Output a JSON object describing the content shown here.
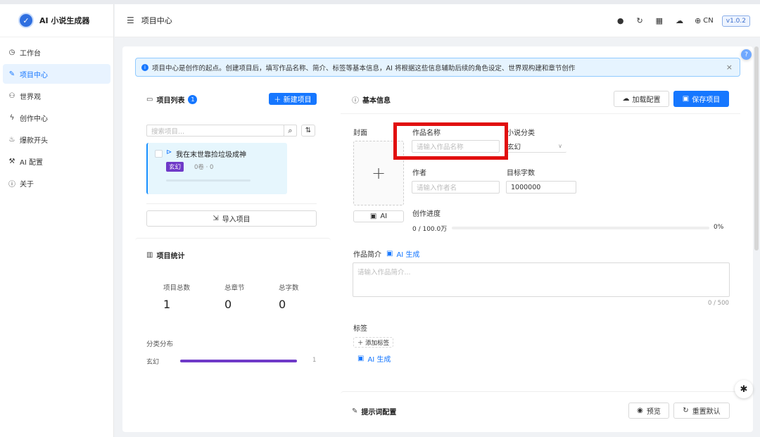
{
  "app": {
    "title": "AI 小说生成器",
    "logo_glyph": "✓"
  },
  "sidebar": {
    "items": [
      {
        "label": "工作台",
        "icon": "dashboard-icon",
        "glyph": "◷"
      },
      {
        "label": "项目中心",
        "icon": "edit-icon",
        "glyph": "✎"
      },
      {
        "label": "世界观",
        "icon": "users-icon",
        "glyph": "⚇"
      },
      {
        "label": "创作中心",
        "icon": "bolt-icon",
        "glyph": "ϟ"
      },
      {
        "label": "爆款开头",
        "icon": "fire-icon",
        "glyph": "♨"
      },
      {
        "label": "AI 配置",
        "icon": "wrench-icon",
        "glyph": "⚒"
      },
      {
        "label": "关于",
        "icon": "info-icon",
        "glyph": "ⓘ"
      }
    ],
    "active_index": 1
  },
  "header": {
    "menu_glyph": "☰",
    "title": "项目中心",
    "tools": [
      {
        "name": "bulb-icon",
        "glyph": "●"
      },
      {
        "name": "refresh-icon",
        "glyph": "↻"
      },
      {
        "name": "grid-icon",
        "glyph": "▦"
      },
      {
        "name": "cloud-icon",
        "glyph": "☁"
      }
    ],
    "lang_glyph": "⊕",
    "lang": "CN",
    "version": "v1.0.2"
  },
  "alert": {
    "text": "项目中心是创作的起点。创建项目后，填写作品名称、简介、标签等基本信息，AI 将根据这些信息辅助后续的角色设定、世界观构建和章节创作",
    "close": "×"
  },
  "project_list": {
    "title": "项目列表",
    "count": "1",
    "new_button": "＋ 新建项目",
    "search_placeholder": "搜索项目...",
    "search_glyph": "⌕",
    "sort_glyph": "⇅",
    "items": [
      {
        "name": "我在末世靠捡垃圾成神",
        "tag": "玄幻",
        "meta": "0卷 · 0"
      }
    ],
    "import_button": "导入项目",
    "import_glyph": "⇲"
  },
  "stats": {
    "title": "项目统计",
    "labels": [
      "项目总数",
      "总章节",
      "总字数"
    ],
    "values": [
      "1",
      "0",
      "0"
    ],
    "dist_title": "分类分布",
    "dist": [
      {
        "label": "玄幻",
        "value": "1",
        "fraction": 1.0,
        "color": "#6f3ac8"
      }
    ]
  },
  "basic": {
    "title": "基本信息",
    "load_button": "加载配置",
    "save_button": "保存项目",
    "cover_label": "封面",
    "cover_plus": "+",
    "ai_button": "AI",
    "name_label": "作品名称",
    "name_placeholder": "请输入作品名称",
    "category_label": "小说分类",
    "category_value": "玄幻",
    "author_label": "作者",
    "author_placeholder": "请输入作者名",
    "target_label": "目标字数",
    "target_value": "1000000",
    "progress_label": "创作进度",
    "progress_text": "0 / 100.0万",
    "progress_percent": "0%",
    "progress_fraction": 0,
    "summary_label": "作品简介",
    "summary_ai": "AI 生成",
    "summary_placeholder": "请输入作品简介...",
    "summary_count": "0 / 500",
    "tags_label": "标签",
    "add_tag": "＋ 添加标签",
    "tags_ai": "AI 生成"
  },
  "prompt": {
    "title": "提示词配置",
    "preview_button": "预览",
    "reset_button": "重置默认"
  },
  "floating": {
    "help": "?",
    "bug": "✱"
  },
  "highlight_color": "#e10e0e",
  "accent_color": "#1677ff"
}
